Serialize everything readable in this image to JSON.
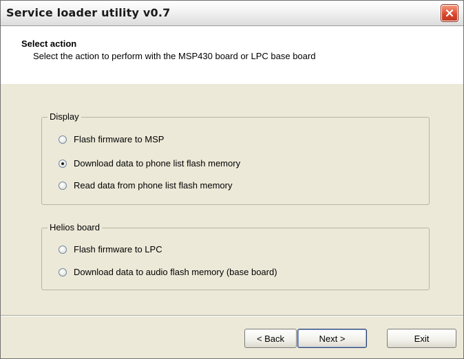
{
  "window": {
    "title": "Service loader utility v0.7"
  },
  "header": {
    "title": "Select action",
    "subtitle": "Select the action to perform with the MSP430 board or LPC base board"
  },
  "display_group": {
    "legend": "Display",
    "options": [
      {
        "label": "Flash firmware to MSP",
        "checked": false
      },
      {
        "label": "Download data to phone list flash memory",
        "checked": true
      },
      {
        "label": "Read data from phone list flash memory",
        "checked": false
      }
    ]
  },
  "helios_group": {
    "legend": "Helios board",
    "options": [
      {
        "label": "Flash firmware to LPC",
        "checked": false
      },
      {
        "label": "Download data to audio flash memory (base board)",
        "checked": false
      }
    ]
  },
  "buttons": {
    "back": "< Back",
    "next": "Next >",
    "exit": "Exit"
  }
}
